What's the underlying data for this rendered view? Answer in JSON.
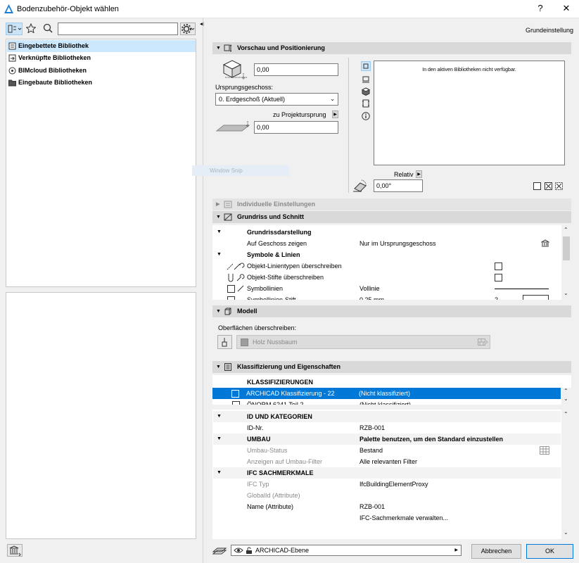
{
  "window": {
    "title": "Bodenzubehör-Objekt wählen",
    "help": "?",
    "close": "✕"
  },
  "left": {
    "search_value": "",
    "library_tree": [
      {
        "label": "Eingebettete Bibliothek",
        "selected": true
      },
      {
        "label": "Verknüpfte Bibliotheken",
        "selected": false
      },
      {
        "label": "BIMcloud Bibliotheken",
        "selected": false
      },
      {
        "label": "Eingebaute Bibliotheken",
        "selected": false
      }
    ]
  },
  "header": {
    "settings_label": "Grundeinstellung"
  },
  "preview": {
    "title": "Vorschau und Positionierung",
    "elevation_value": "0,00",
    "origin_story_label": "Ursprungsgeschoss:",
    "origin_story_value": "0. Erdgeschoß (Aktuell)",
    "to_project_origin_label": "zu Projektursprung",
    "offset_value": "0,00",
    "preview_message": "In den aktiven Bibliotheken nicht verfügbar.",
    "relative_label": "Relativ",
    "angle_value": "0,00°",
    "ghost_text": "Window Snip"
  },
  "sections": {
    "individual": "Individuelle Einstellungen",
    "floorplan": "Grundriss und Schnitt",
    "model": "Modell",
    "classification": "Klassifizierung und Eigenschaften"
  },
  "floorplan_rows": {
    "grp_display": "Grundrissdarstellung",
    "show_on_story_label": "Auf Geschoss zeigen",
    "show_on_story_value": "Nur im Ursprungsgeschoss",
    "grp_symbols": "Symbole & Linien",
    "override_linetypes": "Objekt-Linientypen überschreiben",
    "override_pens": "Objekt-Stifte überschreiben",
    "symbol_lines_label": "Symbollinien",
    "symbol_lines_value": "Vollinie",
    "symbol_pen_label": "Symbollinien-Stift",
    "symbol_pen_value": "0,25 mm",
    "symbol_pen_num": "2"
  },
  "model": {
    "override_surfaces_label": "Oberflächen überschreiben:",
    "surface_value": "Holz Nussbaum"
  },
  "classification": {
    "header": "KLASSIFIZIERUNGEN",
    "rows": [
      {
        "label": "ARCHICAD Klassifizierung - 22",
        "value": "(Nicht klassifiziert)"
      },
      {
        "label": "ÖNORM 6241 Teil 2",
        "value": "(Nicht klassifiziert)"
      }
    ]
  },
  "properties": {
    "grp_id": "ID UND KATEGORIEN",
    "id_label": "ID-Nr.",
    "id_value": "RZB-001",
    "grp_renovation": "UMBAU",
    "renovation_value": "Palette benutzen, um den Standard einzustellen",
    "renovation_status_label": "Umbau-Status",
    "renovation_status_value": "Bestand",
    "renovation_filter_label": "Anzeigen auf Umbau-Filter",
    "renovation_filter_value": "Alle relevanten Filter",
    "grp_ifc": "IFC SACHMERKMALE",
    "ifc_type_label": "IFC Typ",
    "ifc_type_value": "IfcBuildingElementProxy",
    "globalid_label": "GlobalId (Attribute)",
    "globalid_value": "",
    "name_label": "Name (Attribute)",
    "name_value": "RZB-001",
    "manage_ifc": "IFC-Sachmerkmale verwalten..."
  },
  "footer": {
    "layer_value": "ARCHICAD-Ebene",
    "cancel_label": "Abbrechen",
    "ok_label": "OK"
  }
}
